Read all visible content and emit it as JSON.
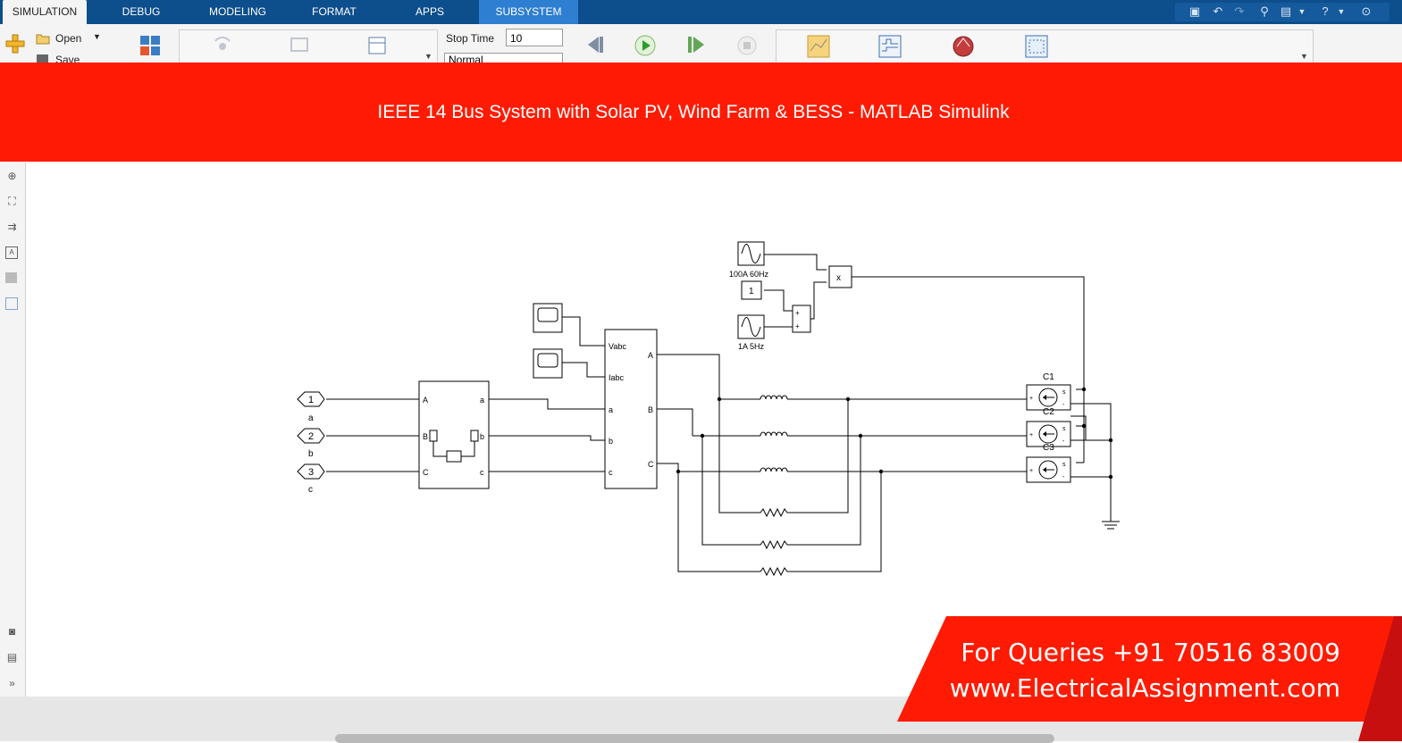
{
  "tabs": [
    {
      "label": "SIMULATION",
      "active": true
    },
    {
      "label": "DEBUG"
    },
    {
      "label": "MODELING"
    },
    {
      "label": "FORMAT"
    },
    {
      "label": "APPS"
    },
    {
      "label": "SUBSYSTEM BLOCK",
      "contextual": true
    }
  ],
  "toolstrip": {
    "open_label": "Open",
    "save_label": "Save",
    "stop_time_label": "Stop Time",
    "stop_time_value": "10",
    "mode_value": "Normal"
  },
  "banner": {
    "title": "IEEE 14 Bus System with Solar PV, Wind Farm & BESS - MATLAB Simulink"
  },
  "diagram": {
    "ports": [
      {
        "num": "1",
        "name": "a"
      },
      {
        "num": "2",
        "name": "b"
      },
      {
        "num": "3",
        "name": "c"
      }
    ],
    "vi_block_in_ports": [
      "A",
      "B",
      "C"
    ],
    "vi_block_out_ports": [
      "a",
      "b",
      "c"
    ],
    "meas_block_ports": {
      "outputs": [
        "Vabc",
        "Iabc"
      ],
      "left": [
        "a",
        "b",
        "c"
      ],
      "right": [
        "A",
        "B",
        "C"
      ]
    },
    "sources": {
      "sine1": "100A 60Hz",
      "const": "1",
      "sine2": "1A 5Hz",
      "product": "x",
      "sum_signs": [
        "+",
        "+"
      ]
    },
    "current_sources": [
      "C1",
      "C2",
      "C3"
    ],
    "cs_port_signs": [
      "s",
      "+",
      "-"
    ]
  },
  "promo": {
    "line1": "For Queries +91 70516 83009",
    "line2": "www.ElectricalAssignment.com"
  },
  "colors": {
    "tab_bar": "#0d4e8c",
    "banner": "#ff1b03",
    "contextual_tab": "#2e7fd1"
  }
}
